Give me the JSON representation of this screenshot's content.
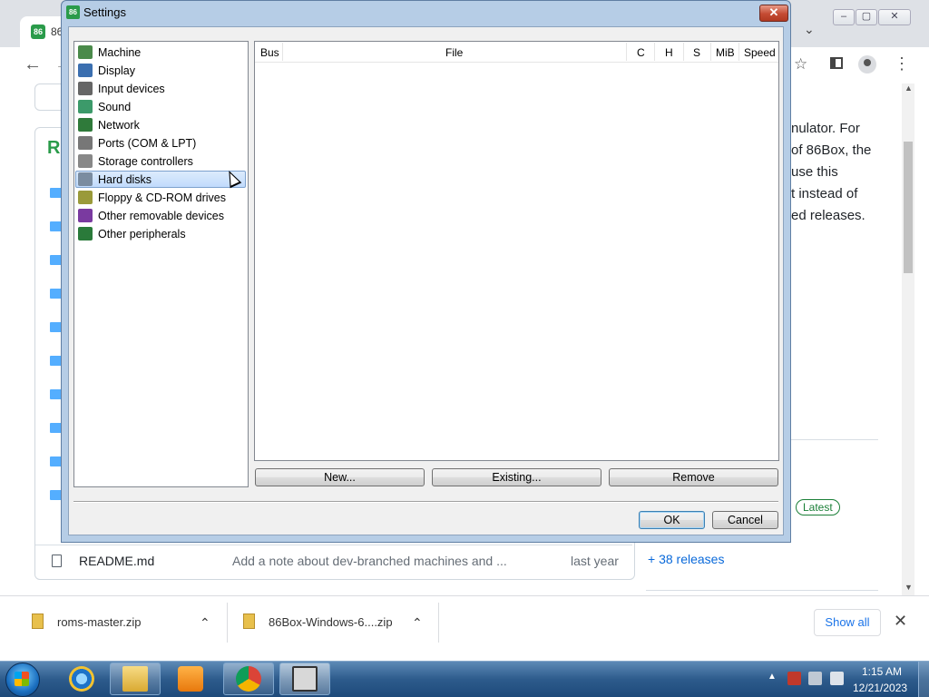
{
  "browser": {
    "tab_title": "86",
    "downloads": [
      {
        "name": "roms-master.zip"
      },
      {
        "name": "86Box-Windows-6....zip"
      }
    ],
    "show_all": "Show all",
    "close_glyph": "✕"
  },
  "page": {
    "readme_name": "README.md",
    "readme_msg": "Add a note about dev-branched machines and ...",
    "readme_time": "last year",
    "about_lines": [
      "nulator. For",
      "of 86Box, the",
      "use this",
      "t instead of",
      "ed releases."
    ],
    "latest_badge": "Latest",
    "releases_link": "+ 38 releases"
  },
  "dialog": {
    "title": "Settings",
    "close_glyph": "✕",
    "categories": [
      {
        "label": "Machine",
        "icon": "machine-icon",
        "color": "#4a8a4a"
      },
      {
        "label": "Display",
        "icon": "display-icon",
        "color": "#3b6fb0"
      },
      {
        "label": "Input devices",
        "icon": "input-devices-icon",
        "color": "#666666"
      },
      {
        "label": "Sound",
        "icon": "sound-icon",
        "color": "#3c9a6a"
      },
      {
        "label": "Network",
        "icon": "network-icon",
        "color": "#2f7a3a"
      },
      {
        "label": "Ports (COM & LPT)",
        "icon": "ports-icon",
        "color": "#777777"
      },
      {
        "label": "Storage controllers",
        "icon": "storage-controllers-icon",
        "color": "#888888"
      },
      {
        "label": "Hard disks",
        "icon": "hard-disks-icon",
        "color": "#7a8ca0"
      },
      {
        "label": "Floppy & CD-ROM drives",
        "icon": "floppy-cdrom-icon",
        "color": "#9a9a3a"
      },
      {
        "label": "Other removable devices",
        "icon": "removable-devices-icon",
        "color": "#7a3aa0"
      },
      {
        "label": "Other peripherals",
        "icon": "peripherals-icon",
        "color": "#2a7a3a"
      }
    ],
    "selected": "Hard disks",
    "columns": [
      "Bus",
      "File",
      "C",
      "H",
      "S",
      "MiB",
      "Speed"
    ],
    "buttons": {
      "new": "New...",
      "existing": "Existing...",
      "remove": "Remove",
      "ok": "OK",
      "cancel": "Cancel"
    }
  },
  "taskbar": {
    "time": "1:15 AM",
    "date": "12/21/2023"
  }
}
